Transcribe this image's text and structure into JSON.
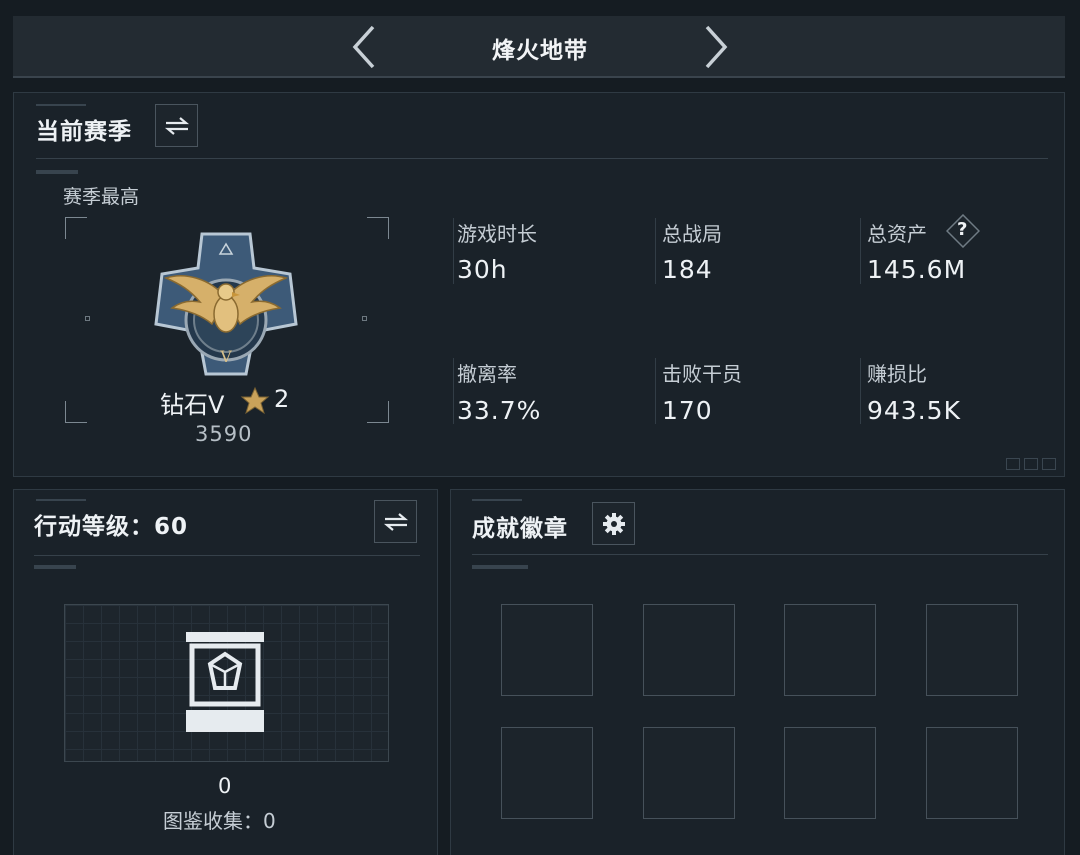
{
  "header": {
    "title": "烽火地带",
    "prev_icon": "chevron-left-icon",
    "next_icon": "chevron-right-icon"
  },
  "season": {
    "title": "当前赛季",
    "switch_icon": "swap-icon",
    "best_label": "赛季最高",
    "rank": {
      "name": "钻石V",
      "stars": "2",
      "score": "3590",
      "emblem_icon": "eagle-emblem-icon",
      "star_icon": "star-icon"
    },
    "stats": [
      {
        "label": "游戏时长",
        "value": "30h"
      },
      {
        "label": "总战局",
        "value": "184"
      },
      {
        "label": "总资产",
        "value": "145.6M",
        "help": "?"
      },
      {
        "label": "撤离率",
        "value": "33.7%"
      },
      {
        "label": "击败干员",
        "value": "170"
      },
      {
        "label": "赚损比",
        "value": "943.5K"
      }
    ]
  },
  "action_level": {
    "title": "行动等级：60",
    "switch_icon": "swap-icon",
    "collection_count": "0",
    "collection_label": "图鉴收集：0",
    "item_icon": "display-case-icon"
  },
  "achievements": {
    "title": "成就徽章",
    "settings_icon": "gear-icon",
    "slots": [
      "",
      "",
      "",
      "",
      "",
      "",
      "",
      ""
    ]
  },
  "colors": {
    "background": "#151c22",
    "panel": "#1a2229",
    "text": "#eef2f5",
    "gold": "#c9a25a"
  }
}
